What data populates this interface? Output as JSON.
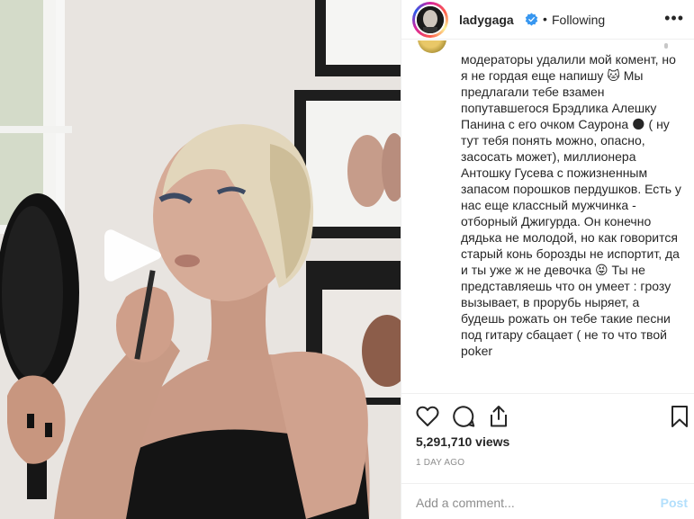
{
  "post": {
    "username": "ladygaga",
    "dot": "•",
    "follow_state": "Following",
    "more": "•••"
  },
  "comment": {
    "text": "модераторы удалили мой комент, но я не гордая еще напишу 🐱 Мы предлагали тебе взамен попутавшегося Брэдлика Алешку Панина с его очком Саурона 🌑 ( ну тут тебя понять можно, опасно, засосать может), миллионера Антошку Гусева с пожизненным запасом порошков пердушков. Есть у нас еще классный мужчинка - отборный Джигурда. Он конечно дядька не молодой, но как говорится старый конь борозды не испортит, да и ты уже ж не девочка 😝 Ты не представляешь что он умеет : грозу вызывает, в прорубь ныряет, а будешь рожать он тебе такие песни под гитару сбацает ( не то что твой poker"
  },
  "stats": {
    "views": "5,291,710 views",
    "time": "1 DAY AGO"
  },
  "composer": {
    "placeholder": "Add a comment...",
    "post_label": "Post"
  },
  "icons": {
    "verified": "verified-badge-icon",
    "like": "heart-icon",
    "comment": "comment-bubble-icon",
    "share": "share-icon",
    "save": "bookmark-icon",
    "play": "play-icon"
  },
  "colors": {
    "text": "#262626",
    "muted": "#8e8e8e",
    "verified": "#3897f0",
    "post_disabled": "#b2dffc",
    "border": "#efefef"
  }
}
